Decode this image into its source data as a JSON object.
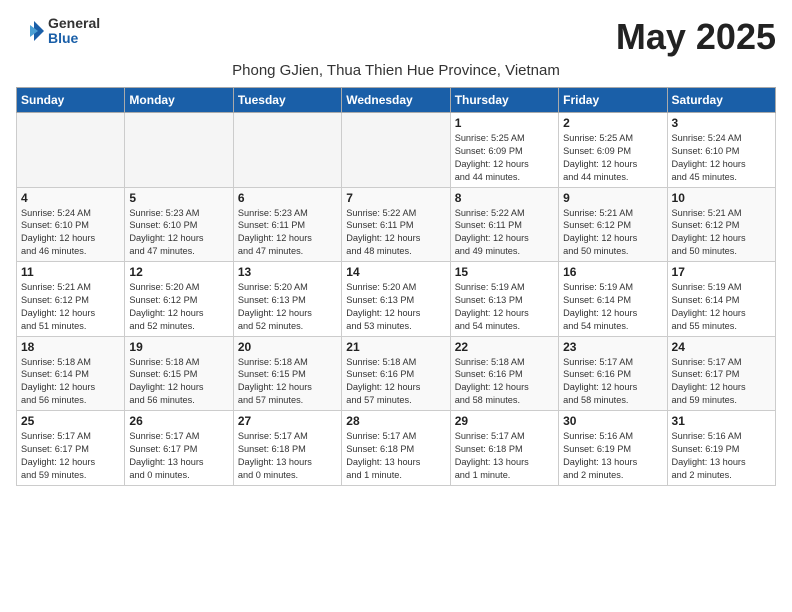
{
  "header": {
    "logo_general": "General",
    "logo_blue": "Blue",
    "month_year": "May 2025",
    "location": "Phong GJien, Thua Thien Hue Province, Vietnam"
  },
  "weekdays": [
    "Sunday",
    "Monday",
    "Tuesday",
    "Wednesday",
    "Thursday",
    "Friday",
    "Saturday"
  ],
  "weeks": [
    [
      {
        "day": "",
        "info": ""
      },
      {
        "day": "",
        "info": ""
      },
      {
        "day": "",
        "info": ""
      },
      {
        "day": "",
        "info": ""
      },
      {
        "day": "1",
        "info": "Sunrise: 5:25 AM\nSunset: 6:09 PM\nDaylight: 12 hours\nand 44 minutes."
      },
      {
        "day": "2",
        "info": "Sunrise: 5:25 AM\nSunset: 6:09 PM\nDaylight: 12 hours\nand 44 minutes."
      },
      {
        "day": "3",
        "info": "Sunrise: 5:24 AM\nSunset: 6:10 PM\nDaylight: 12 hours\nand 45 minutes."
      }
    ],
    [
      {
        "day": "4",
        "info": "Sunrise: 5:24 AM\nSunset: 6:10 PM\nDaylight: 12 hours\nand 46 minutes."
      },
      {
        "day": "5",
        "info": "Sunrise: 5:23 AM\nSunset: 6:10 PM\nDaylight: 12 hours\nand 47 minutes."
      },
      {
        "day": "6",
        "info": "Sunrise: 5:23 AM\nSunset: 6:11 PM\nDaylight: 12 hours\nand 47 minutes."
      },
      {
        "day": "7",
        "info": "Sunrise: 5:22 AM\nSunset: 6:11 PM\nDaylight: 12 hours\nand 48 minutes."
      },
      {
        "day": "8",
        "info": "Sunrise: 5:22 AM\nSunset: 6:11 PM\nDaylight: 12 hours\nand 49 minutes."
      },
      {
        "day": "9",
        "info": "Sunrise: 5:21 AM\nSunset: 6:12 PM\nDaylight: 12 hours\nand 50 minutes."
      },
      {
        "day": "10",
        "info": "Sunrise: 5:21 AM\nSunset: 6:12 PM\nDaylight: 12 hours\nand 50 minutes."
      }
    ],
    [
      {
        "day": "11",
        "info": "Sunrise: 5:21 AM\nSunset: 6:12 PM\nDaylight: 12 hours\nand 51 minutes."
      },
      {
        "day": "12",
        "info": "Sunrise: 5:20 AM\nSunset: 6:12 PM\nDaylight: 12 hours\nand 52 minutes."
      },
      {
        "day": "13",
        "info": "Sunrise: 5:20 AM\nSunset: 6:13 PM\nDaylight: 12 hours\nand 52 minutes."
      },
      {
        "day": "14",
        "info": "Sunrise: 5:20 AM\nSunset: 6:13 PM\nDaylight: 12 hours\nand 53 minutes."
      },
      {
        "day": "15",
        "info": "Sunrise: 5:19 AM\nSunset: 6:13 PM\nDaylight: 12 hours\nand 54 minutes."
      },
      {
        "day": "16",
        "info": "Sunrise: 5:19 AM\nSunset: 6:14 PM\nDaylight: 12 hours\nand 54 minutes."
      },
      {
        "day": "17",
        "info": "Sunrise: 5:19 AM\nSunset: 6:14 PM\nDaylight: 12 hours\nand 55 minutes."
      }
    ],
    [
      {
        "day": "18",
        "info": "Sunrise: 5:18 AM\nSunset: 6:14 PM\nDaylight: 12 hours\nand 56 minutes."
      },
      {
        "day": "19",
        "info": "Sunrise: 5:18 AM\nSunset: 6:15 PM\nDaylight: 12 hours\nand 56 minutes."
      },
      {
        "day": "20",
        "info": "Sunrise: 5:18 AM\nSunset: 6:15 PM\nDaylight: 12 hours\nand 57 minutes."
      },
      {
        "day": "21",
        "info": "Sunrise: 5:18 AM\nSunset: 6:16 PM\nDaylight: 12 hours\nand 57 minutes."
      },
      {
        "day": "22",
        "info": "Sunrise: 5:18 AM\nSunset: 6:16 PM\nDaylight: 12 hours\nand 58 minutes."
      },
      {
        "day": "23",
        "info": "Sunrise: 5:17 AM\nSunset: 6:16 PM\nDaylight: 12 hours\nand 58 minutes."
      },
      {
        "day": "24",
        "info": "Sunrise: 5:17 AM\nSunset: 6:17 PM\nDaylight: 12 hours\nand 59 minutes."
      }
    ],
    [
      {
        "day": "25",
        "info": "Sunrise: 5:17 AM\nSunset: 6:17 PM\nDaylight: 12 hours\nand 59 minutes."
      },
      {
        "day": "26",
        "info": "Sunrise: 5:17 AM\nSunset: 6:17 PM\nDaylight: 13 hours\nand 0 minutes."
      },
      {
        "day": "27",
        "info": "Sunrise: 5:17 AM\nSunset: 6:18 PM\nDaylight: 13 hours\nand 0 minutes."
      },
      {
        "day": "28",
        "info": "Sunrise: 5:17 AM\nSunset: 6:18 PM\nDaylight: 13 hours\nand 1 minute."
      },
      {
        "day": "29",
        "info": "Sunrise: 5:17 AM\nSunset: 6:18 PM\nDaylight: 13 hours\nand 1 minute."
      },
      {
        "day": "30",
        "info": "Sunrise: 5:16 AM\nSunset: 6:19 PM\nDaylight: 13 hours\nand 2 minutes."
      },
      {
        "day": "31",
        "info": "Sunrise: 5:16 AM\nSunset: 6:19 PM\nDaylight: 13 hours\nand 2 minutes."
      }
    ]
  ]
}
